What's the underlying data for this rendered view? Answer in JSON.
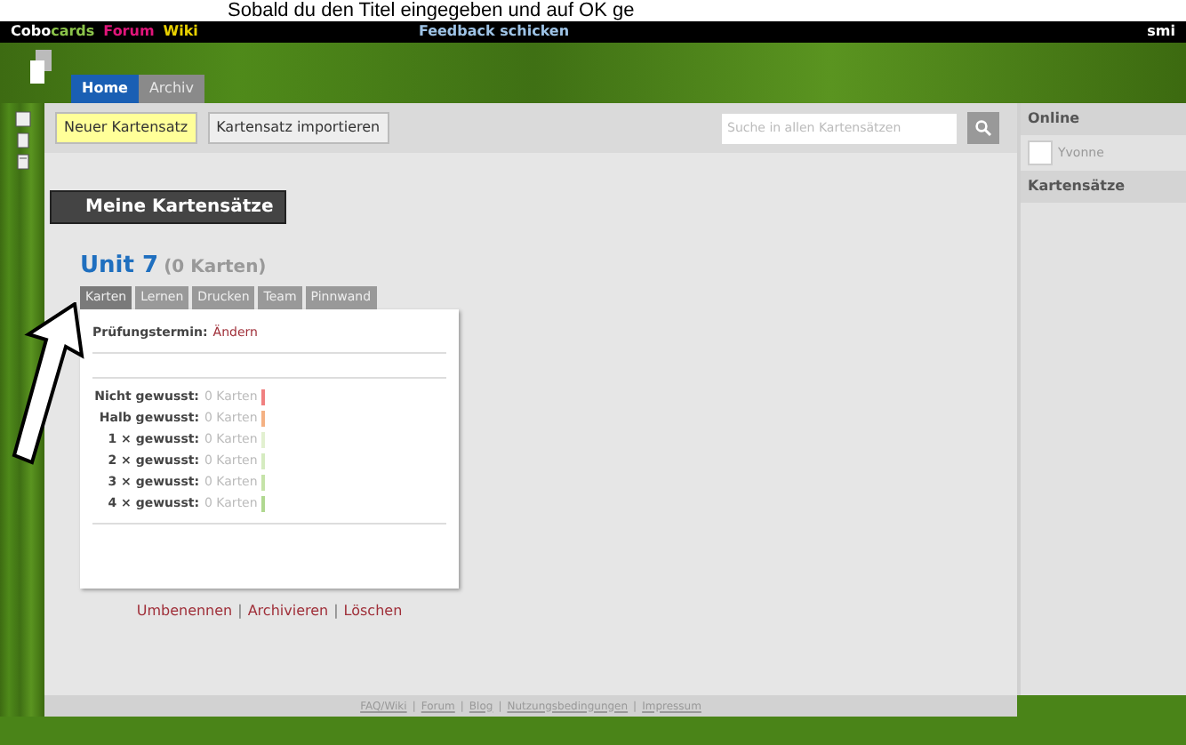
{
  "caption": "Sobald du den Titel eingegeben und auf OK ge",
  "topbar": {
    "logo": [
      "Cobo",
      "cards"
    ],
    "links": [
      "Forum",
      "Wiki"
    ],
    "feedback": "Feedback schicken",
    "user": "smi"
  },
  "nav_tabs": [
    {
      "label": "Home",
      "selected": true
    },
    {
      "label": "Archiv",
      "selected": false
    }
  ],
  "toolbar": {
    "buttons": [
      {
        "label": "Neuer Kartensatz",
        "kind": "primary"
      },
      {
        "label": "Kartensatz importieren",
        "kind": "secondary"
      }
    ],
    "search": {
      "placeholder": "Suche in allen Kartensätzen"
    }
  },
  "section_title": "Meine Kartensätze",
  "deck": {
    "title": "Unit 7",
    "count": "(0 Karten)",
    "tabs": [
      {
        "label": "Karten",
        "selected": true
      },
      {
        "label": "Lernen",
        "selected": false
      },
      {
        "label": "Drucken",
        "selected": false
      },
      {
        "label": "Team",
        "selected": false
      },
      {
        "label": "Pinnwand",
        "selected": false
      }
    ],
    "exam": {
      "label": "Prüfungstermin:",
      "link": "Ändern"
    },
    "levels": [
      {
        "label": "Nicht gewusst:",
        "value": "0 Karten",
        "color": "#f08080"
      },
      {
        "label": "Halb gewusst:",
        "value": "0 Karten",
        "color": "#f4b183"
      },
      {
        "label": "1 × gewusst:",
        "value": "0 Karten",
        "color": "#e2f0d0"
      },
      {
        "label": "2 × gewusst:",
        "value": "0 Karten",
        "color": "#d5ebc0"
      },
      {
        "label": "3 × gewusst:",
        "value": "0 Karten",
        "color": "#c5e3a8"
      },
      {
        "label": "4 × gewusst:",
        "value": "0 Karten",
        "color": "#b0d890"
      }
    ],
    "actions": [
      "Umbenennen",
      "Archivieren",
      "Löschen"
    ],
    "separator": "|"
  },
  "sidebar": {
    "sections": [
      {
        "title": "Online",
        "users": [
          "Yvonne"
        ]
      },
      {
        "title": "Kartensätze"
      }
    ]
  },
  "footer": {
    "links": [
      "FAQ/Wiki",
      "Forum",
      "Blog",
      "Nutzungsbedingungen",
      "Impressum"
    ],
    "separator": "|"
  }
}
